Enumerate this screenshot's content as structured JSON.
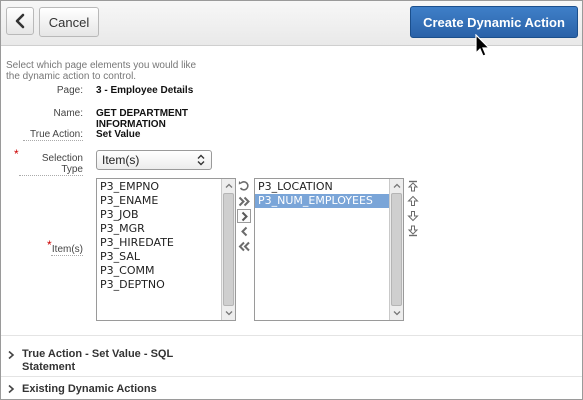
{
  "header": {
    "back_icon": "chevron-left-icon",
    "cancel_label": "Cancel",
    "create_label": "Create Dynamic Action"
  },
  "instructions": "Select which page elements you would like the dynamic action to control.",
  "form": {
    "page_label": "Page:",
    "page_value": "3 - Employee Details",
    "name_label": "Name:",
    "name_value": "GET DEPARTMENT INFORMATION",
    "true_action_label": "True Action:",
    "true_action_value": "Set Value",
    "selection_type_label": "Selection Type",
    "selection_type_value": "Item(s)",
    "items_label": "Item(s)",
    "required_mark": "*"
  },
  "available_items": [
    "P3_EMPNO",
    "P3_ENAME",
    "P3_JOB",
    "P3_MGR",
    "P3_HIREDATE",
    "P3_SAL",
    "P3_COMM",
    "P3_DEPTNO"
  ],
  "selected_items": [
    "P3_LOCATION",
    "P3_NUM_EMPLOYEES"
  ],
  "selected_highlight_index": 1,
  "sections": {
    "true_action_line1": "True Action - Set Value - SQL",
    "true_action_line2": "Statement",
    "existing": "Existing Dynamic Actions"
  },
  "colors": {
    "accent": "#2a62a8",
    "selection": "#7aa5d8",
    "required": "#cc0000"
  }
}
